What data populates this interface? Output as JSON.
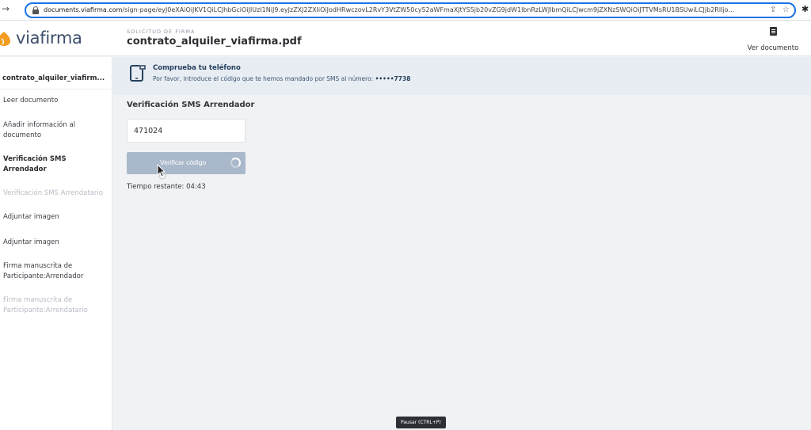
{
  "browser": {
    "url_domain": "documents.viafirma.com",
    "url_path": "/sign-page/eyJ0eXAiOiJKV1QiLCJhbGciOiJIUzI1NiJ9.eyJzZXJ2ZXIiOiJodHRwczovL2RvY3VtZW50cy52aWFmaXJtYS5jb20vZG9jdW1lbnRzLWJlbmQiLCJwcm9jZXNzSWQiOiJTTVMsRU1BSUwiLCJjb2RlIjo..."
  },
  "brand": {
    "name": "viafirma",
    "colors": {
      "orange": "#f39c1f",
      "text": "#3c4f6b",
      "accent": "#a9b8ca",
      "banner": "#e8edf3"
    }
  },
  "header": {
    "kicker": "SOLICITUD DE FIRMA",
    "document_name": "contrato_alquiler_viafirma.pdf",
    "view_document": "Ver documento"
  },
  "sidebar": {
    "title": "contrato_alquiler_viafirm...",
    "items": [
      {
        "label": "Leer documento",
        "state": "normal"
      },
      {
        "label": "Añadir información al documento",
        "state": "normal"
      },
      {
        "label": "Verificación SMS Arrendador",
        "state": "active"
      },
      {
        "label": "Verificación SMS Arrendatario",
        "state": "disabled"
      },
      {
        "label": "Adjuntar imagen",
        "state": "normal"
      },
      {
        "label": "Adjuntar imagen",
        "state": "normal"
      },
      {
        "label": "Firma manuscrita de Participante:Arrendador",
        "state": "normal"
      },
      {
        "label": "Firma manuscrita de Participante:Arrendatario",
        "state": "disabled"
      }
    ]
  },
  "banner": {
    "title": "Comprueba tu teléfono",
    "text": "Por favor, introduce el código que te hemos mandado por SMS al número:",
    "phone": "•••••7738"
  },
  "verification": {
    "title": "Verificación SMS Arrendador",
    "code_value": "471024",
    "button_label": "Verificar código",
    "timer_text": "Tiempo restante: 04:43"
  },
  "tooltip": {
    "pause": "Pausar (CTRL+P)"
  },
  "icons": [
    "back-arrow-icon",
    "lock-icon",
    "share-icon",
    "star-icon",
    "extensions-icon",
    "viafirma-logo-icon",
    "document-icon",
    "phone-icon",
    "spinner-icon",
    "cursor-icon"
  ]
}
